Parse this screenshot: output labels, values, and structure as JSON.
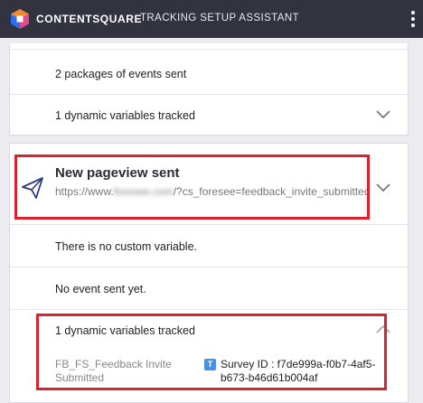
{
  "header": {
    "brand": "CONTENTSQUARE",
    "title": "TRACKING SETUP ASSISTANT"
  },
  "card1": {
    "packages_text": "2 packages of events sent",
    "dynamic_vars_text": "1 dynamic variables tracked"
  },
  "card2": {
    "title": "New pageview sent",
    "url_prefix": "https://www.",
    "url_blurred": "foresee.com",
    "url_suffix": "/?cs_foresee=feedback_invite_submitted",
    "no_custom_var": "There is no custom variable.",
    "no_event": "No event sent yet.",
    "dynamic_vars_text": "1 dynamic variables tracked",
    "variable": {
      "name": "FB_FS_Feedback Invite Submitted",
      "badge": "T",
      "value": "Survey ID : f7de999a-f0b7-4af5-b673-b46d61b004af"
    }
  },
  "colors": {
    "header_bg": "#33323f",
    "highlight_red": "#d8232f",
    "badge_blue": "#4a90e2"
  },
  "icons": [
    "contentsquare-logo-icon",
    "menu-dots-icon",
    "chevron-down-icon",
    "paper-plane-icon",
    "chevron-up-icon"
  ]
}
